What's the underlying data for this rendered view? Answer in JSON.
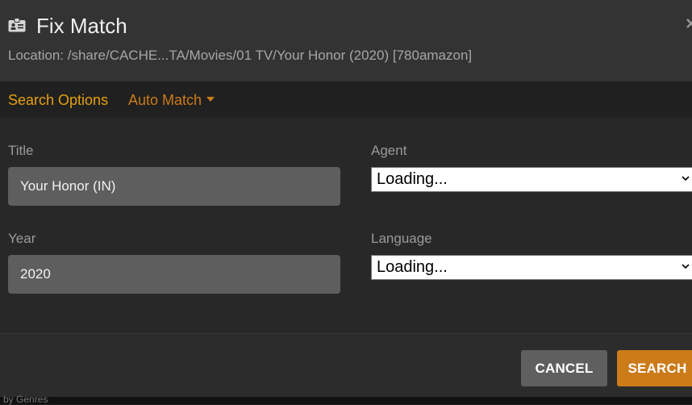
{
  "dialog": {
    "title": "Fix Match",
    "title_icon": "id-card-icon",
    "close_icon": "close-icon",
    "location": "Location: /share/CACHE...TA/Movies/01 TV/Your Honor (2020) [780amazon]"
  },
  "tabs": {
    "search_options": "Search Options",
    "auto_match": "Auto Match"
  },
  "form": {
    "title_label": "Title",
    "title_value": "Your Honor (IN)",
    "year_label": "Year",
    "year_value": "2020",
    "agent_label": "Agent",
    "agent_value": "Loading...",
    "language_label": "Language",
    "language_value": "Loading..."
  },
  "buttons": {
    "cancel": "CANCEL",
    "search": "SEARCH"
  },
  "background": {
    "text": "by Genres"
  },
  "colors": {
    "accent": "#e5a00d",
    "button_orange": "#cc7b19",
    "dialog_bg": "#282828"
  }
}
